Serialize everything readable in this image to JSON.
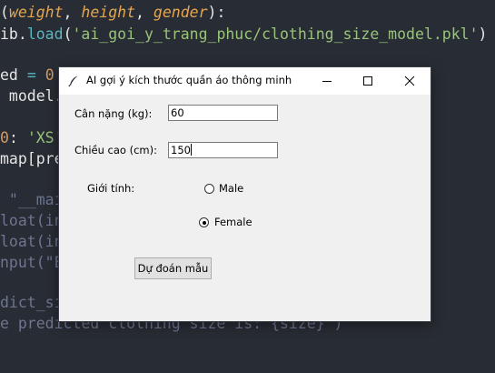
{
  "editor": {
    "line1": {
      "open": "(",
      "p1": "weight",
      "sep1": ", ",
      "p2": "height",
      "sep2": ", ",
      "p3": "gender",
      "close": "):"
    },
    "line2": {
      "pre": "ib.",
      "fn": "load",
      "open": "(",
      "str": "'ai_goi_y_trang_phuc/clothing_size_model.pkl'",
      "close": ")"
    },
    "line3": {
      "pre": "ed ",
      "op": "=",
      "space": " ",
      "num": "0"
    },
    "line4": {
      "text": " model."
    },
    "line5": {
      "num": "0",
      "colon": ": ",
      "str": "'XS'"
    },
    "line6": {
      "text": "map[pre"
    },
    "line7": {
      "text": " \"__mai"
    },
    "line8": {
      "text": "loat(in"
    },
    "line9": {
      "text": "loat(in"
    },
    "line10": {
      "text": "nput(\"E"
    },
    "line11": {
      "text": "dict_si"
    },
    "line12": {
      "text": "e predicted clothing size is: {size}\")"
    }
  },
  "window": {
    "title": "AI gợi ý kích thước quần áo thông minh",
    "weight_label": "Cân nặng (kg):",
    "weight_value": "60",
    "height_label": "Chiều cao (cm):",
    "height_value": "150",
    "gender_label": "Giới tính:",
    "gender_options": [
      "Male",
      "Female"
    ],
    "gender_selected": "Female",
    "predict_button": "Dự đoán mẫu"
  },
  "colors": {
    "editor_bg": "#282c34",
    "window_bg": "#f0f0f0",
    "param": "#e5a64f",
    "string": "#98c379",
    "number": "#d19a66"
  },
  "icons": [
    "feather-icon",
    "minimize-icon",
    "maximize-icon",
    "close-icon"
  ]
}
